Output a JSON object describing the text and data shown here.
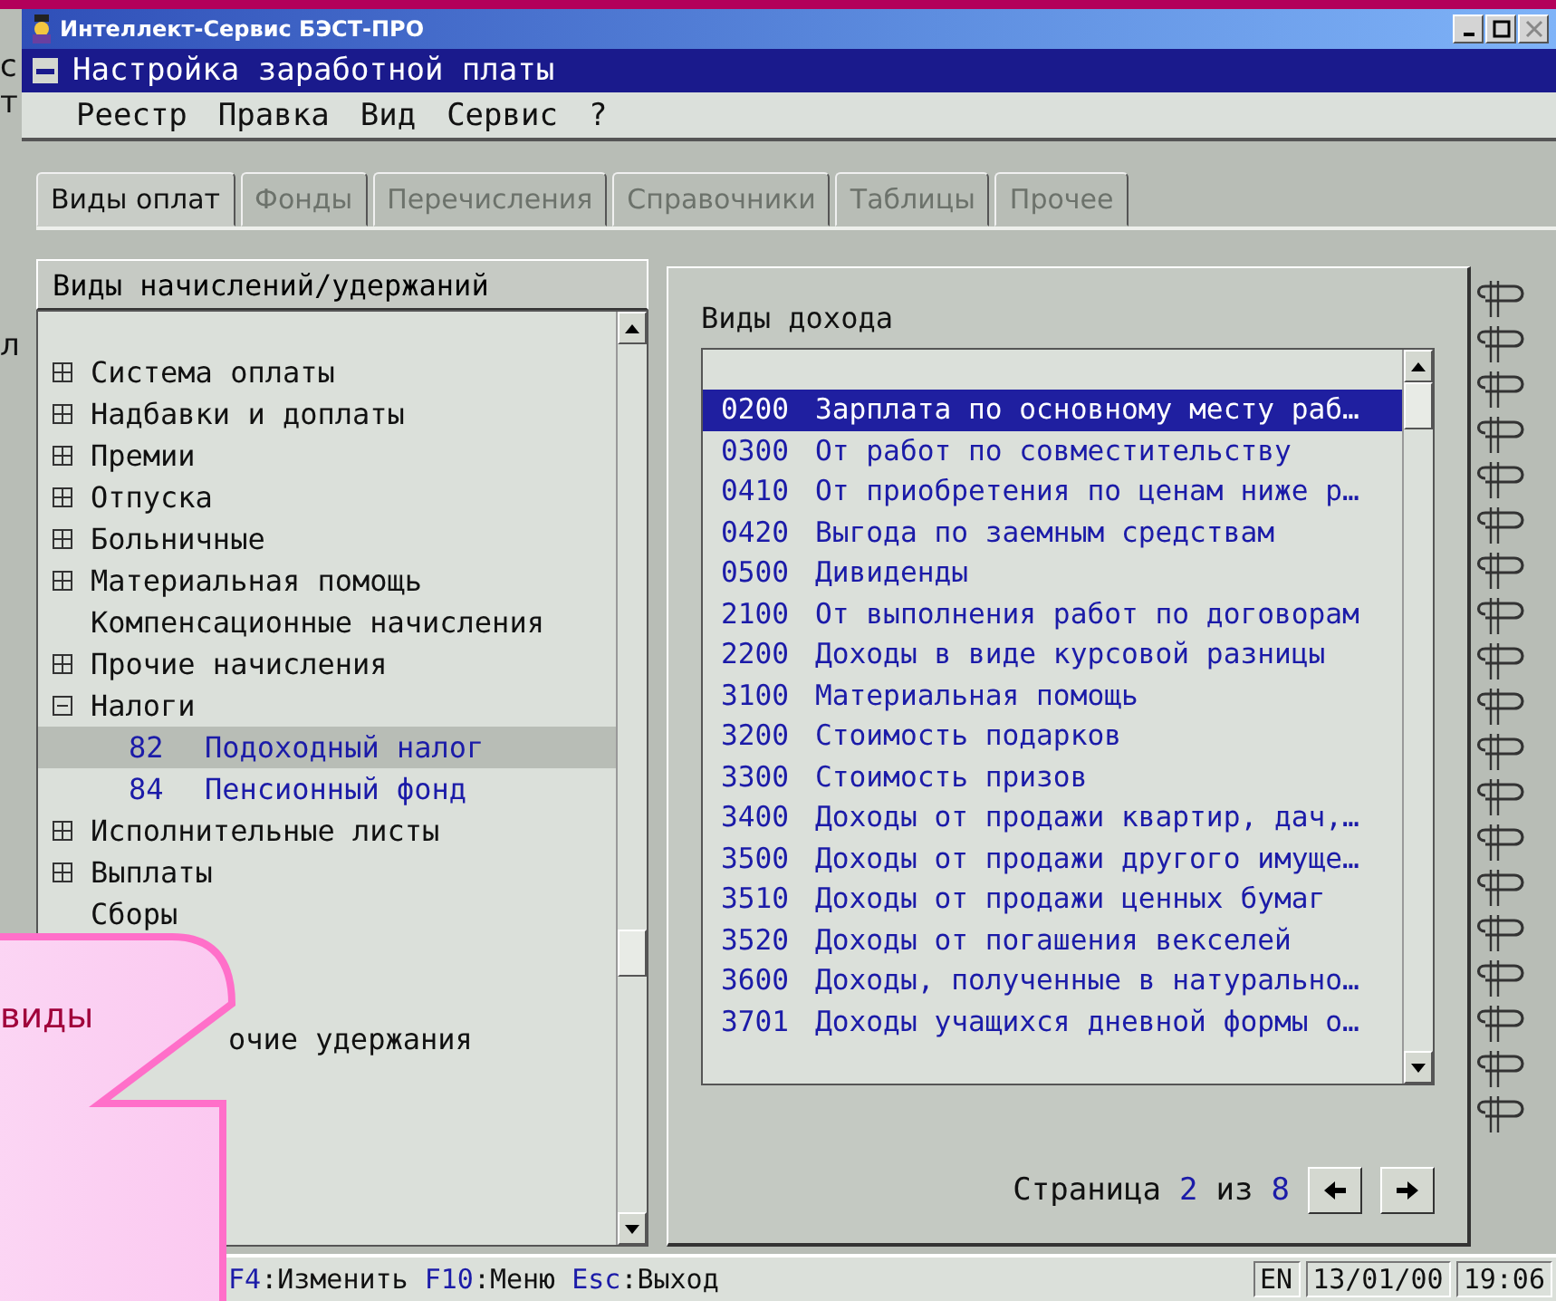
{
  "background_fragments": [
    "с",
    "т",
    "л"
  ],
  "window": {
    "title": "Интеллект-Сервис БЭСТ-ПРО"
  },
  "document": {
    "title": "Настройка заработной платы"
  },
  "menu": [
    "Реестр",
    "Правка",
    "Вид",
    "Сервис",
    "?"
  ],
  "tabs": [
    {
      "label": "Виды оплат",
      "selected": true,
      "disabled": false
    },
    {
      "label": "Фонды",
      "selected": false,
      "disabled": true
    },
    {
      "label": "Перечисления",
      "selected": false,
      "disabled": true
    },
    {
      "label": "Справочники",
      "selected": false,
      "disabled": true
    },
    {
      "label": "Таблицы",
      "selected": false,
      "disabled": true
    },
    {
      "label": "Прочее",
      "selected": false,
      "disabled": true
    }
  ],
  "left_panel": {
    "title": "Виды начислений/удержаний",
    "tree": [
      {
        "label": "Система оплаты",
        "kind": "group",
        "expanded": false,
        "selected": false
      },
      {
        "label": "Надбавки и доплаты",
        "kind": "group",
        "expanded": false,
        "selected": false
      },
      {
        "label": "Премии",
        "kind": "group",
        "expanded": false,
        "selected": false
      },
      {
        "label": "Отпуска",
        "kind": "group",
        "expanded": false,
        "selected": false
      },
      {
        "label": "Больничные",
        "kind": "group",
        "expanded": false,
        "selected": false
      },
      {
        "label": "Материальная помощь",
        "kind": "group",
        "expanded": false,
        "selected": false
      },
      {
        "label": "Компенсационные начисления",
        "kind": "leaf",
        "selected": false
      },
      {
        "label": "Прочие начисления",
        "kind": "group",
        "expanded": false,
        "selected": false
      },
      {
        "label": "Налоги",
        "kind": "group",
        "expanded": true,
        "selected": false,
        "children": [
          {
            "code": "82",
            "label": "Подоходный налог",
            "selected": true
          },
          {
            "code": "84",
            "label": "Пенсионный фонд",
            "selected": false
          }
        ]
      },
      {
        "label": "Исполнительные листы",
        "kind": "group",
        "expanded": false,
        "selected": false
      },
      {
        "label": "Выплаты",
        "kind": "group",
        "expanded": false,
        "selected": false
      },
      {
        "label": "Сборы",
        "kind": "covered",
        "selected": false
      },
      {
        "label": "очие удержания",
        "kind": "covered",
        "selected": false
      }
    ]
  },
  "right_panel": {
    "title": "Виды дохода",
    "items": [
      {
        "code": "0200",
        "label": "Зарплата по основному месту раб…",
        "selected": true
      },
      {
        "code": "0300",
        "label": "От работ по совместительству",
        "selected": false
      },
      {
        "code": "0410",
        "label": "От приобретения по ценам ниже р…",
        "selected": false
      },
      {
        "code": "0420",
        "label": "Выгода по заемным средствам",
        "selected": false
      },
      {
        "code": "0500",
        "label": "Дивиденды",
        "selected": false
      },
      {
        "code": "2100",
        "label": "От выполнения работ по договорам",
        "selected": false
      },
      {
        "code": "2200",
        "label": "Доходы в виде курсовой разницы",
        "selected": false
      },
      {
        "code": "3100",
        "label": "Материальная помощь",
        "selected": false
      },
      {
        "code": "3200",
        "label": "Стоимость подарков",
        "selected": false
      },
      {
        "code": "3300",
        "label": "Стоимость призов",
        "selected": false
      },
      {
        "code": "3400",
        "label": "Доходы от продажи квартир, дач,…",
        "selected": false
      },
      {
        "code": "3500",
        "label": "Доходы от продажи другого имуще…",
        "selected": false
      },
      {
        "code": "3510",
        "label": "Доходы от продажи ценных бумаг",
        "selected": false
      },
      {
        "code": "3520",
        "label": "Доходы от погашения векселей",
        "selected": false
      },
      {
        "code": "3600",
        "label": "Доходы, полученные в натурально…",
        "selected": false
      },
      {
        "code": "3701",
        "label": "Доходы учащихся дневной формы о…",
        "selected": false
      }
    ],
    "pager": {
      "label": "Страница",
      "current": "2",
      "of": "из",
      "total": "8"
    }
  },
  "status_bar": {
    "keys": [
      {
        "key": "F4",
        "label": ":Изменить"
      },
      {
        "key": "F10",
        "label": ":Меню"
      },
      {
        "key": "Esc",
        "label": ":Выход"
      }
    ],
    "lang": "EN",
    "date": "13/01/00",
    "time": "19:06"
  },
  "callout": {
    "text": "виды"
  }
}
